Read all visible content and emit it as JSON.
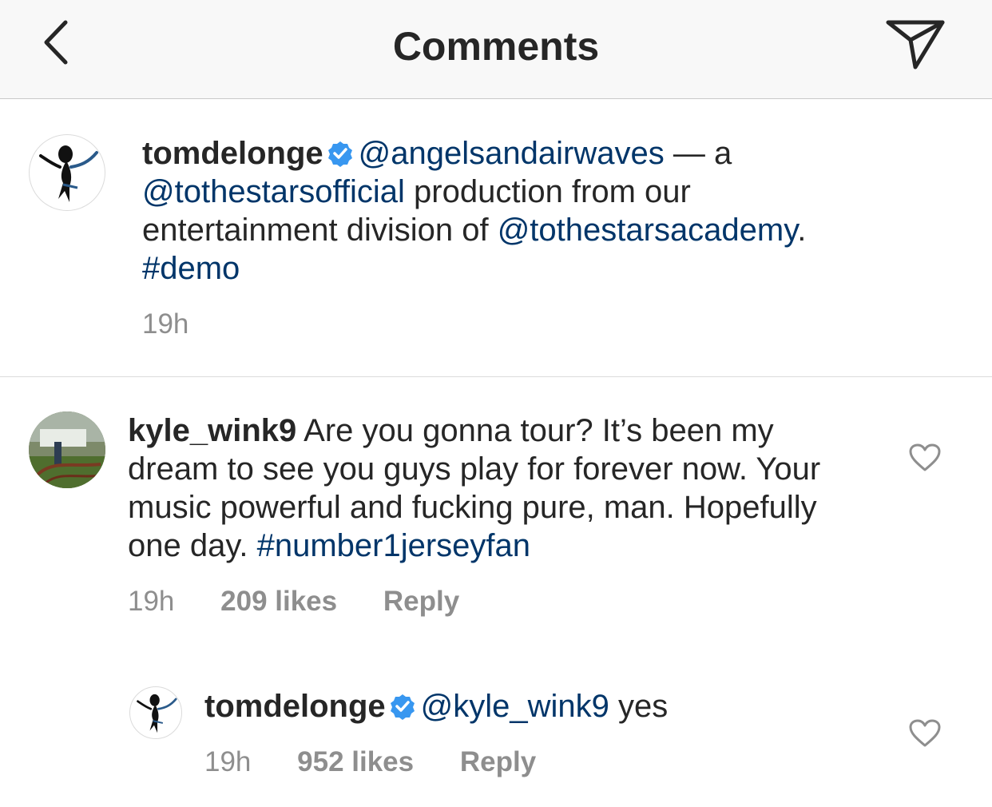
{
  "header": {
    "title": "Comments",
    "back_icon": "chevron-left-icon",
    "share_icon": "paper-plane-icon"
  },
  "colors": {
    "link": "#003569",
    "verified": "#3897f0",
    "meta": "#8e8e8e",
    "header_bg": "#f8f8f8"
  },
  "caption": {
    "username": "tomdelonge",
    "verified": true,
    "mention_1": "@angelsandairwaves",
    "text_1": " — a",
    "mention_2": "@tothestarsofficial",
    "text_2": " production from our entertainment division of ",
    "mention_3": "@tothestarsacademy",
    "text_3": ".  ",
    "hashtag": "#demo",
    "time": "19h"
  },
  "comments": [
    {
      "username": "kyle_wink9",
      "text": "Are you gonna tour? It’s been my dream to see you guys play for forever now. Your music powerful and fucking pure, man. Hopefully one day. ",
      "hashtag": "#number1jerseyfan",
      "time": "19h",
      "likes": "209 likes",
      "reply_label": "Reply"
    }
  ],
  "reply": {
    "username": "tomdelonge",
    "verified": true,
    "mention": "@kyle_wink9",
    "text": " yes",
    "time": "19h",
    "likes": "952 likes",
    "reply_label": "Reply"
  }
}
